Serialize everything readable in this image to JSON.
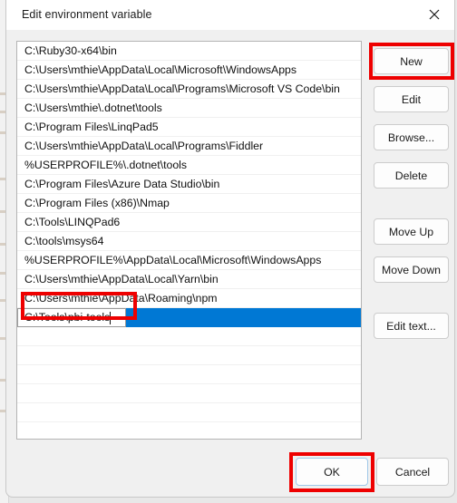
{
  "window": {
    "title": "Edit environment variable",
    "close_icon": "close-icon"
  },
  "list": {
    "items": [
      "C:\\Ruby30-x64\\bin",
      "C:\\Users\\mthie\\AppData\\Local\\Microsoft\\WindowsApps",
      "C:\\Users\\mthie\\AppData\\Local\\Programs\\Microsoft VS Code\\bin",
      "C:\\Users\\mthie\\.dotnet\\tools",
      "C:\\Program Files\\LinqPad5",
      "C:\\Users\\mthie\\AppData\\Local\\Programs\\Fiddler",
      "%USERPROFILE%\\.dotnet\\tools",
      "C:\\Program Files\\Azure Data Studio\\bin",
      "C:\\Program Files (x86)\\Nmap",
      "C:\\Tools\\LINQPad6",
      "C:\\tools\\msys64",
      "%USERPROFILE%\\AppData\\Local\\Microsoft\\WindowsApps",
      "C:\\Users\\mthie\\AppData\\Local\\Yarn\\bin",
      "C:\\Users\\mthie\\AppData\\Roaming\\npm"
    ],
    "selected_index": 14,
    "editing_value": "C:\\Tools\\pbi-tools",
    "blank_rows": 6,
    "selection_color": "#0078d4"
  },
  "side_buttons": {
    "new": "New",
    "edit": "Edit",
    "browse": "Browse...",
    "delete": "Delete",
    "move_up": "Move Up",
    "move_down": "Move Down",
    "edit_text": "Edit text..."
  },
  "footer": {
    "ok": "OK",
    "cancel": "Cancel"
  },
  "annotations": {
    "color": "#ee0000",
    "targets": [
      "new-button",
      "inline-edit-row",
      "ok-button"
    ]
  }
}
